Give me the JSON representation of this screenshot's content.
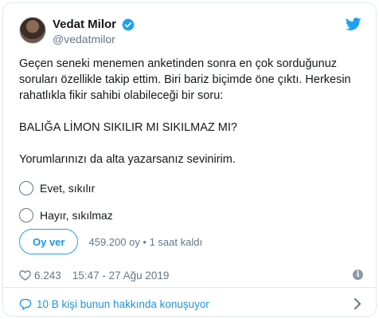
{
  "user": {
    "display_name": "Vedat Milor",
    "handle": "@vedatmilor"
  },
  "icons": {
    "avatar": "avatar",
    "verified": "verified-badge-icon",
    "brand": "twitter-bird-icon",
    "like": "heart-icon",
    "info": "info-icon",
    "conversation": "speech-bubble-icon",
    "chevron": "chevron-right-icon"
  },
  "colors": {
    "accent": "#1da1f2",
    "link": "#1b95e0",
    "muted": "#657786",
    "text": "#14171a",
    "border": "#e1e8ed"
  },
  "tweet": {
    "lines": [
      "Geçen seneki menemen anketinden sonra en çok sorduğunuz",
      "soruları özellikle takip ettim. Biri bariz biçimde öne çıktı. Herkesin",
      "rahatlıkla fikir sahibi olabileceği bir soru:"
    ],
    "question": "BALIĞA LİMON SIKILIR MI SIKILMAZ MI?",
    "closing": "Yorumlarınızı da alta yazarsanız sevinirim."
  },
  "poll": {
    "options": [
      {
        "label": "Evet, sıkılır"
      },
      {
        "label": "Hayır, sıkılmaz"
      }
    ],
    "vote_label": "Oy ver",
    "meta": "459.200 oy • 1 saat kaldı"
  },
  "footer": {
    "likes": "6.243",
    "timestamp": "15:47 - 27 Ağu 2019"
  },
  "conversation": {
    "text": "10 B kişi bunun hakkında konuşuyor"
  }
}
